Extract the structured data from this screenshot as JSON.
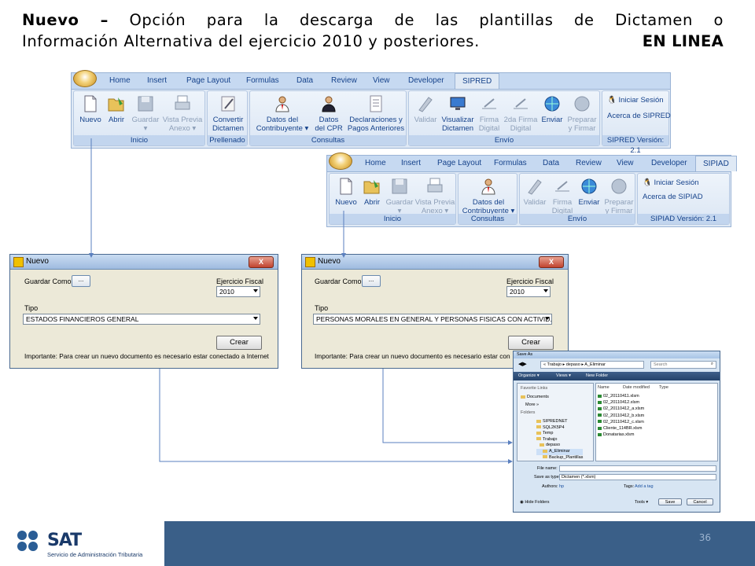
{
  "title": {
    "lead": "Nuevo –",
    "line1_rest": " Opción para la descarga de las plantillas de Dictamen o",
    "line2": "Información Alternativa del ejercicio 2010 y posteriores.",
    "tag": "EN LINEA"
  },
  "sipred": {
    "tabs": [
      "Home",
      "Insert",
      "Page Layout",
      "Formulas",
      "Data",
      "Review",
      "View",
      "Developer",
      "SIPRED"
    ],
    "groups": {
      "inicio": {
        "label": "Inicio",
        "buttons": [
          "Nuevo",
          "Abrir",
          "Guardar",
          "Vista Previa",
          "Anexo"
        ]
      },
      "prellenado": {
        "label": "Prellenado",
        "buttons": [
          "Convertir",
          "Dictamen"
        ]
      },
      "consultas": {
        "label": "Consultas",
        "b1a": "Datos del",
        "b1b": "Contribuyente",
        "b2a": "Datos",
        "b2b": "del CPR",
        "b3a": "Declaraciones y",
        "b3b": "Pagos Anteriores"
      },
      "envio": {
        "label": "Envío",
        "b1": "Validar",
        "b2a": "Visualizar",
        "b2b": "Dictamen",
        "b3a": "Firma",
        "b3b": "Digital",
        "b4a": "2da Firma",
        "b4b": "Digital",
        "b5": "Enviar",
        "b6a": "Preparar",
        "b6b": "y Firmar"
      },
      "session": {
        "login": "Iniciar Sesión",
        "about": "Acerca de SIPRED",
        "version": "SIPRED Versión: 2.1"
      }
    }
  },
  "sipiad": {
    "tabs": [
      "Home",
      "Insert",
      "Page Layout",
      "Formulas",
      "Data",
      "Review",
      "View",
      "Developer",
      "SIPIAD"
    ],
    "groups": {
      "inicio": {
        "label": "Inicio",
        "buttons": [
          "Nuevo",
          "Abrir",
          "Guardar",
          "Vista Previa",
          "Anexo"
        ]
      },
      "consultas": {
        "label": "Consultas",
        "b1a": "Datos del",
        "b1b": "Contribuyente"
      },
      "envio": {
        "label": "Envío",
        "b1": "Validar",
        "b3a": "Firma",
        "b3b": "Digital",
        "b5": "Enviar",
        "b6a": "Preparar",
        "b6b": "y Firmar"
      },
      "session": {
        "login": "Iniciar Sesión",
        "about": "Acerca de SIPIAD",
        "version": "SIPIAD Versión: 2.1"
      }
    }
  },
  "dialog1": {
    "title": "Nuevo",
    "close": "X",
    "save_as": "Guardar Como",
    "browse": "...",
    "year_label": "Ejercicio Fiscal",
    "year": "2010",
    "type_label": "Tipo",
    "type_value": "ESTADOS FINANCIEROS GENERAL",
    "create": "Crear",
    "note": "Importante: Para crear un nuevo documento es necesario estar conectado a Internet"
  },
  "dialog2": {
    "title": "Nuevo",
    "close": "X",
    "save_as": "Guardar Como",
    "browse": "...",
    "year_label": "Ejercicio Fiscal",
    "year": "2010",
    "type_label": "Tipo",
    "type_value": "PERSONAS MORALES EN GENERAL Y PERSONAS FISICAS CON ACTIVID.",
    "create": "Crear",
    "note": "Importante: Para crear un nuevo documento es necesario estar con"
  },
  "saveas": {
    "title": "Save As",
    "path": "« Trabajo  ▸  depaso  ▸  A_Eliminar",
    "search": "Search",
    "organize": "Organize ▾",
    "views": "Views ▾",
    "newfolder": "New Folder",
    "fav_label": "Favorite Links",
    "documents": "Documents",
    "more": "More »",
    "folders_label": "Folders",
    "folders": [
      "SIPREDNET",
      "SQL2K5P4",
      "Temp",
      "Trabajo",
      "depaso",
      "A_Eliminar",
      "Backup_Plantillas"
    ],
    "col_name": "Name",
    "col_date": "Date modified",
    "col_type": "Type",
    "files": [
      "02_20110411.xlsm",
      "02_20110412.xlsm",
      "02_20110412_a.xlsm",
      "02_20110412_b.xlsm",
      "02_20110412_c.xlsm",
      "Cliente_114BR.xlsm",
      "Donatarias.xlsm"
    ],
    "filename_label": "File name:",
    "saveas_label": "Save as type:",
    "saveas_value": "Dictamen (*.xlsm)",
    "authors_label": "Authors:",
    "authors_value": "hp",
    "tags_label": "Tags:",
    "tags_value": "Add a tag",
    "hide": "Hide Folders",
    "tools": "Tools ▾",
    "save": "Save",
    "cancel": "Cancel"
  },
  "footer": {
    "logo": "SAT",
    "subtitle": "Servicio de Administración Tributaria",
    "page": "36"
  },
  "colors": {
    "accent": "#3a5f88",
    "ribbon": "#dfe9f5",
    "connector": "#5a7fbf"
  }
}
